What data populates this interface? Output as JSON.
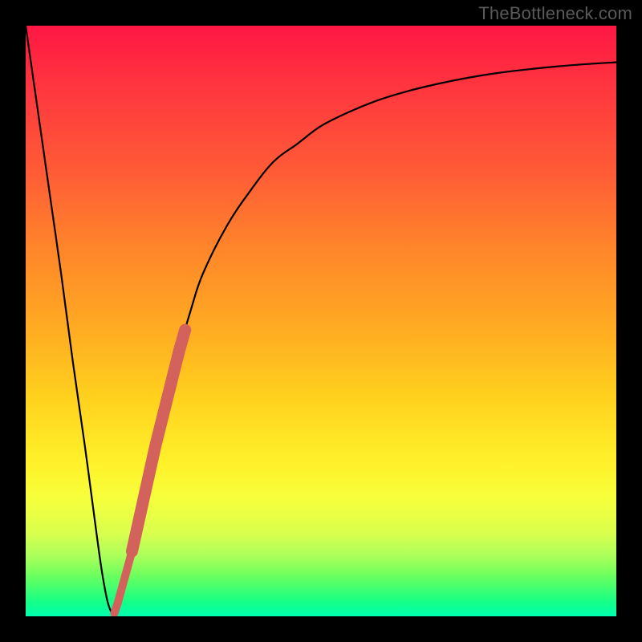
{
  "watermark": "TheBottleneck.com",
  "colors": {
    "page_bg": "#000000",
    "curve": "#000000",
    "highlight": "#d2625b",
    "gradient_top": "#ff1744",
    "gradient_bottom": "#00ffb0"
  },
  "chart_data": {
    "type": "line",
    "title": "",
    "xlabel": "",
    "ylabel": "",
    "xlim": [
      0,
      100
    ],
    "ylim": [
      0,
      100
    ],
    "series": [
      {
        "name": "bottleneck-curve",
        "x": [
          0,
          2,
          4,
          6,
          8,
          10,
          12,
          13,
          14,
          15,
          16,
          18,
          20,
          22,
          24,
          26,
          28,
          30,
          34,
          38,
          42,
          46,
          50,
          55,
          60,
          65,
          70,
          75,
          80,
          85,
          90,
          95,
          100
        ],
        "y": [
          100,
          86,
          72,
          58,
          43,
          29,
          14,
          7,
          2,
          0.5,
          3,
          11,
          20,
          29,
          37,
          45,
          52,
          58,
          66,
          72,
          77,
          80,
          83,
          85.5,
          87.5,
          89,
          90.2,
          91.2,
          92,
          92.6,
          93.1,
          93.5,
          93.8
        ]
      },
      {
        "name": "highlighted-segment",
        "x": [
          18,
          19,
          20,
          21,
          22,
          23,
          24,
          25,
          26,
          27
        ],
        "y": [
          11,
          15.5,
          20,
          24.5,
          29,
          33,
          37,
          41,
          45,
          48.5
        ]
      },
      {
        "name": "highlight-hook",
        "x": [
          15,
          15.6,
          16.4,
          17.2,
          18
        ],
        "y": [
          0.5,
          2.3,
          5.2,
          8.1,
          11
        ]
      }
    ]
  }
}
